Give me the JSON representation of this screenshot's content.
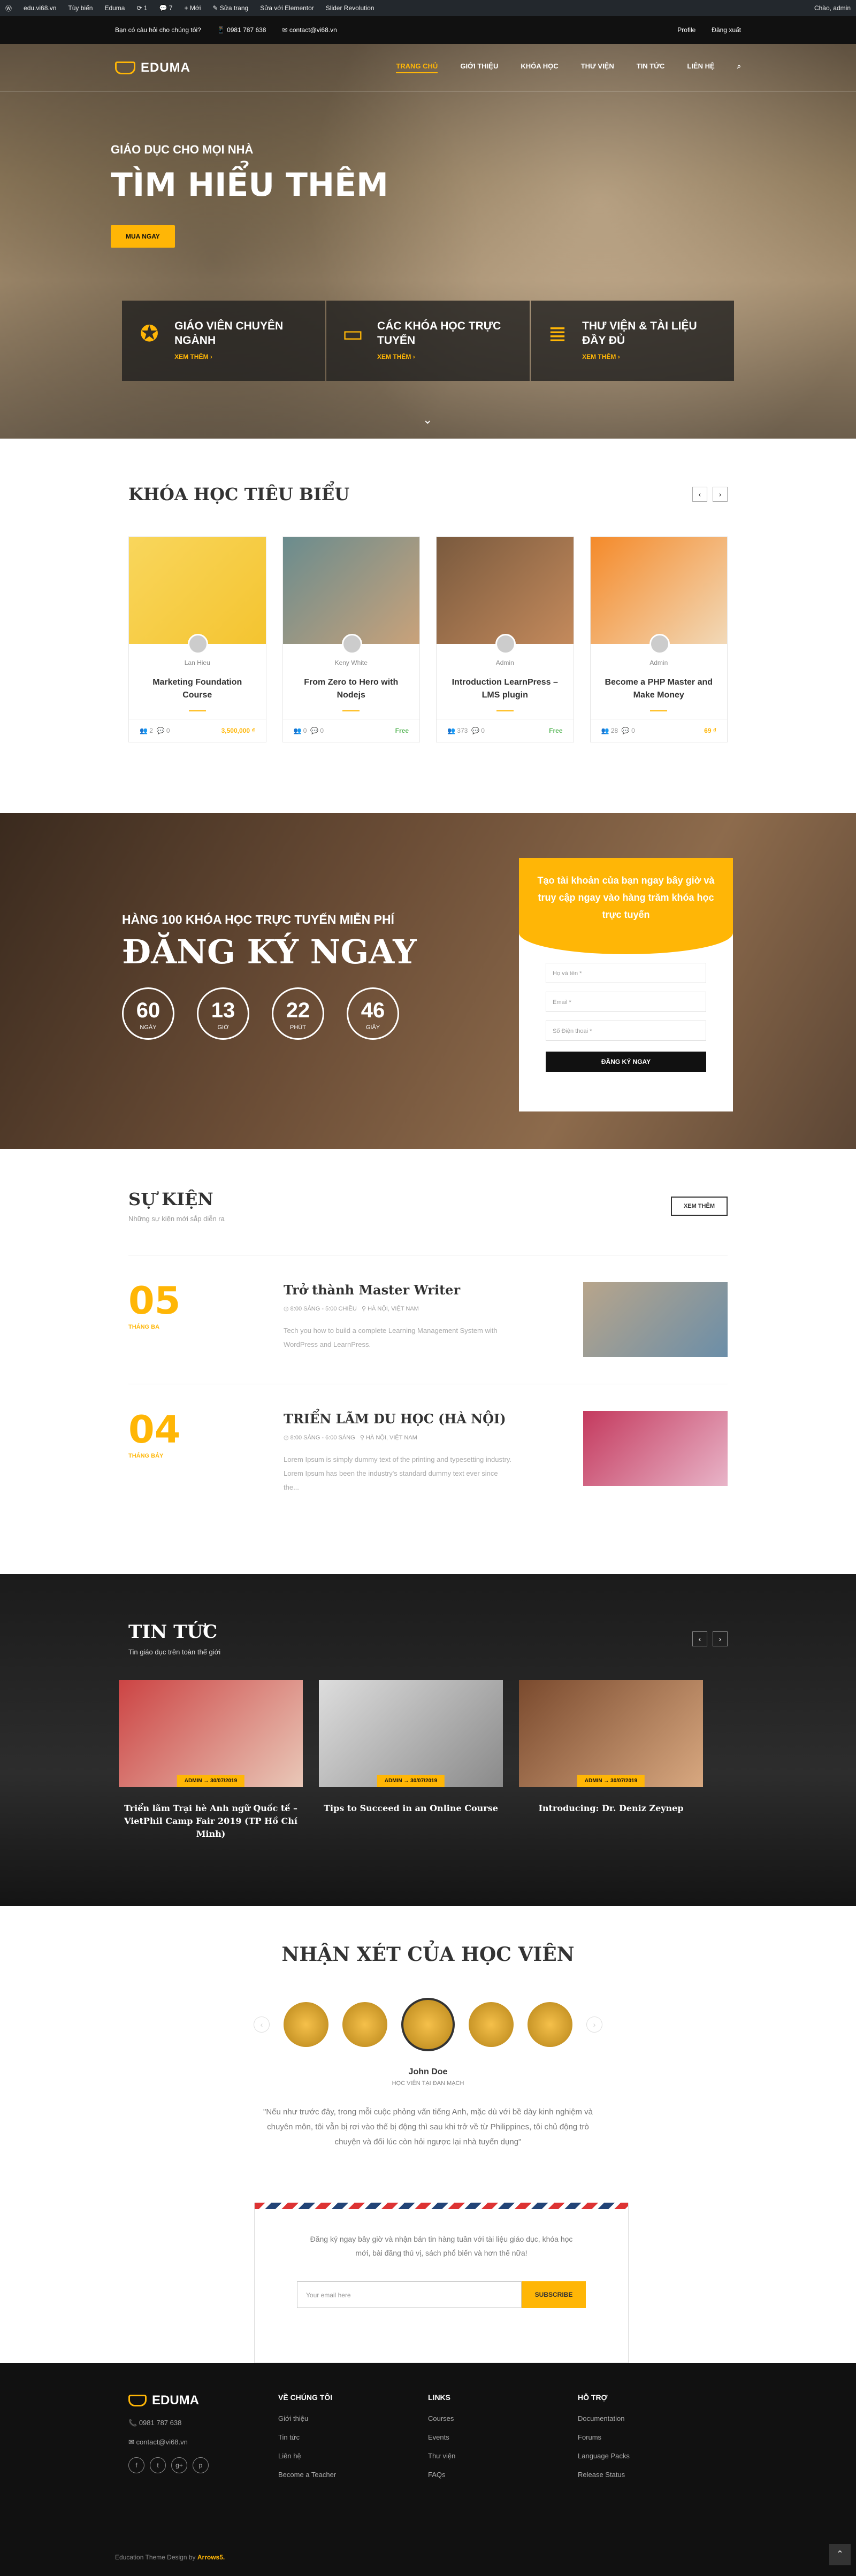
{
  "wpbar": {
    "items": [
      "edu.vi68.vn",
      "Tùy biến",
      "Eduma",
      "1",
      "7",
      "+ Mới",
      "Sửa trang",
      "Sửa với Elementor",
      "Slider Revolution"
    ],
    "right": "Chào, admin"
  },
  "topbar": {
    "q": "Bạn có câu hỏi cho chúng tôi?",
    "phone": "0981 787 638",
    "email": "contact@vi68.vn",
    "profile": "Profile",
    "logout": "Đăng xuất"
  },
  "nav": {
    "logo": "EDUMA",
    "menu": [
      "TRANG CHỦ",
      "GIỚI THIỆU",
      "KHÓA HỌC",
      "THƯ VIỆN",
      "TIN TỨC",
      "LIÊN HỆ"
    ]
  },
  "hero": {
    "sub": "GIÁO DỤC CHO MỌI NHÀ",
    "title": "TÌM HIỂU THÊM",
    "btn": "MUA NGAY",
    "feats": [
      {
        "t": "GIÁO VIÊN CHUYÊN NGÀNH",
        "m": "XEM THÊM ›"
      },
      {
        "t": "CÁC KHÓA HỌC TRỰC TUYẾN",
        "m": "XEM THÊM ›"
      },
      {
        "t": "THƯ VIỆN & TÀI LIỆU ĐẦY ĐỦ",
        "m": "XEM THÊM ›"
      }
    ]
  },
  "courses": {
    "title": "KHÓA HỌC TIÊU BIỂU",
    "items": [
      {
        "a": "Lan Hieu",
        "t": "Marketing Foundation Course",
        "s": "2",
        "c": "0",
        "p": "3,500,000 ₫"
      },
      {
        "a": "Keny White",
        "t": "From Zero to Hero with Nodejs",
        "s": "0",
        "c": "0",
        "p": "Free"
      },
      {
        "a": "Admin",
        "t": "Introduction LearnPress – LMS plugin",
        "s": "373",
        "c": "0",
        "p": "Free"
      },
      {
        "a": "Admin",
        "t": "Become a PHP Master and Make Money",
        "s": "28",
        "c": "0",
        "p": "69 ₫"
      }
    ]
  },
  "reg": {
    "sub": "HÀNG 100 KHÓA HỌC TRỰC TUYẾN MIỄN PHÍ",
    "title": "ĐĂNG KÝ NGAY",
    "count": [
      {
        "n": "60",
        "l": "NGÀY"
      },
      {
        "n": "13",
        "l": "GIỜ"
      },
      {
        "n": "22",
        "l": "PHÚT"
      },
      {
        "n": "46",
        "l": "GIÂY"
      }
    ],
    "form": {
      "head": "Tạo tài khoản của bạn ngay bây giờ và truy cập ngay vào hàng trăm khóa học trực tuyến",
      "f1": "Họ và tên *",
      "f2": "Email *",
      "f3": "Số Điện thoại *",
      "btn": "ĐĂNG KÝ NGAY"
    }
  },
  "events": {
    "title": "SỰ KIỆN",
    "sub": "Những sự kiện mới sắp diễn ra",
    "btn": "XEM THÊM",
    "items": [
      {
        "d": "05",
        "m": "THÁNG BA",
        "t": "Trở thành Master Writer",
        "time": "8:00 SÁNG - 5:00 CHIỀU",
        "loc": "HÀ NỘI, VIỆT NAM",
        "desc": "Tech you how to build a complete Learning Management System with WordPress and LearnPress."
      },
      {
        "d": "04",
        "m": "THÁNG BẢY",
        "t": "TRIỂN LÃM DU HỌC (HÀ NỘI)",
        "time": "8:00 SÁNG - 6:00 SÁNG",
        "loc": "HÀ NỘI, VIỆT NAM",
        "desc": "Lorem Ipsum is simply dummy text of the printing and typesetting industry. Lorem Ipsum has been the industry's standard dummy text ever since the..."
      }
    ]
  },
  "news": {
    "title": "TIN TỨC",
    "sub": "Tin giáo dục trên toàn thế giới",
    "items": [
      {
        "tag": "ADMIN → 30/07/2019",
        "t": "Triển lãm Trại hè Anh ngữ Quốc tế – VietPhil Camp Fair 2019 (TP Hồ Chí Minh)"
      },
      {
        "tag": "ADMIN → 30/07/2019",
        "t": "Tips to Succeed in an Online Course"
      },
      {
        "tag": "ADMIN → 30/07/2019",
        "t": "Introducing: Dr. Deniz Zeynep"
      }
    ]
  },
  "testi": {
    "title": "NHẬN XÉT CỦA HỌC VIÊN",
    "name": "John Doe",
    "role": "HỌC VIÊN TẠI ĐAN MẠCH",
    "quote": "\"Nếu như trước đây, trong mỗi cuộc phỏng vấn tiếng Anh, mặc dù với bề dày kinh nghiệm và chuyên môn, tôi vẫn bị rơi vào thế bị động thì sau khi trở về từ Philippines, tôi chủ động trò chuyện và đối lúc còn hỏi ngược lại nhà tuyển dụng\"",
    "nl_text": "Đăng ký ngay bây giờ và nhận bản tin hàng tuần với tài liệu giáo dục, khóa học mới, bài đăng thú vị, sách phổ biến và hơn thế nữa!",
    "nl_ph": "Your email here",
    "nl_btn": "SUBSCRIBE"
  },
  "footer": {
    "logo": "EDUMA",
    "phone": "0981 787 638",
    "email": "contact@vi68.vn",
    "cols": [
      {
        "h": "VỀ CHÚNG TÔI",
        "l": [
          "Giới thiệu",
          "Tin tức",
          "Liên hệ",
          "Become a Teacher"
        ]
      },
      {
        "h": "LINKS",
        "l": [
          "Courses",
          "Events",
          "Thư viện",
          "FAQs"
        ]
      },
      {
        "h": "HỖ TRỢ",
        "l": [
          "Documentation",
          "Forums",
          "Language Packs",
          "Release Status"
        ]
      }
    ],
    "copy": "Education Theme Design by",
    "brand": "Arrows5."
  }
}
